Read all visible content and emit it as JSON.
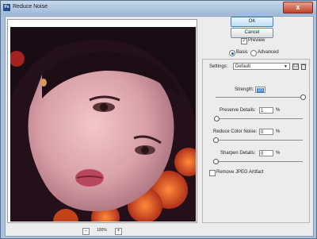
{
  "window": {
    "title": "Reduce Noise",
    "close_label": "x"
  },
  "buttons": {
    "ok": "OK",
    "cancel": "Cancel"
  },
  "preview": {
    "label": "Preview",
    "checked": true
  },
  "mode": {
    "basic": "Basic",
    "advanced": "Advanced",
    "selected": "basic"
  },
  "settings": {
    "label": "Settings:",
    "value": "Default",
    "save_icon": "save-icon",
    "delete_icon": "trash-icon"
  },
  "controls": [
    {
      "key": "strength",
      "label": "Strength:",
      "value": "10",
      "unit": "",
      "level": 1.0
    },
    {
      "key": "preserve",
      "label": "Preserve Details:",
      "value": "1",
      "unit": "%",
      "level": 0.01
    },
    {
      "key": "color_noise",
      "label": "Reduce Color Noise:",
      "value": "0",
      "unit": "%",
      "level": 0.0
    },
    {
      "key": "sharpen",
      "label": "Sharpen Details:",
      "value": "0",
      "unit": "%",
      "level": 0.0
    }
  ],
  "jpeg": {
    "label": "Remove JPEG Artifact",
    "checked": false
  },
  "zoom": {
    "level": "100%",
    "minus": "-",
    "plus": "+"
  }
}
